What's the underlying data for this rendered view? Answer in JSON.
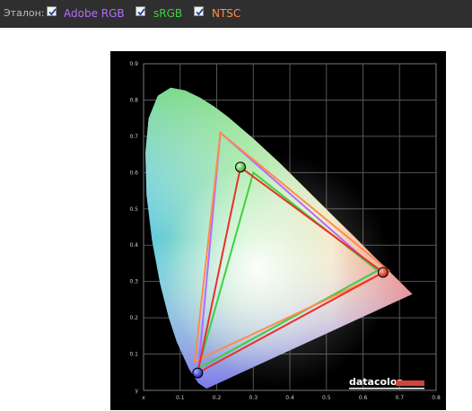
{
  "header": {
    "label": "Эталон:",
    "standards": [
      {
        "name": "Adobe RGB",
        "checked": true,
        "color": "#b36bff"
      },
      {
        "name": "sRGB",
        "checked": true,
        "color": "#3fd13f"
      },
      {
        "name": "NTSC",
        "checked": true,
        "color": "#ff8c4a"
      }
    ]
  },
  "chart_data": {
    "type": "scatter",
    "title": "",
    "xlabel": "x",
    "ylabel": "y",
    "xlim": [
      0,
      0.8
    ],
    "ylim": [
      0,
      0.9
    ],
    "grid": true,
    "x_ticks": [
      "x",
      "0.1",
      "0.2",
      "0.3",
      "0.4",
      "0.5",
      "0.6",
      "0.7",
      "0.8"
    ],
    "y_ticks": [
      "y",
      "0.1",
      "0.2",
      "0.3",
      "0.4",
      "0.5",
      "0.6",
      "0.7",
      "0.8",
      "0.9"
    ],
    "series": [
      {
        "name": "Adobe RGB",
        "color": "#b36bff",
        "x": [
          0.64,
          0.21,
          0.15
        ],
        "y": [
          0.33,
          0.71,
          0.06
        ]
      },
      {
        "name": "sRGB",
        "color": "#3fd13f",
        "x": [
          0.64,
          0.3,
          0.15
        ],
        "y": [
          0.33,
          0.6,
          0.06
        ]
      },
      {
        "name": "NTSC",
        "color": "#ff8c4a",
        "x": [
          0.67,
          0.21,
          0.14
        ],
        "y": [
          0.33,
          0.71,
          0.08
        ]
      },
      {
        "color": "#e8302a",
        "x": [
          0.655,
          0.265,
          0.148
        ],
        "y": [
          0.325,
          0.615,
          0.048
        ]
      }
    ],
    "watermark": "datacolor"
  }
}
